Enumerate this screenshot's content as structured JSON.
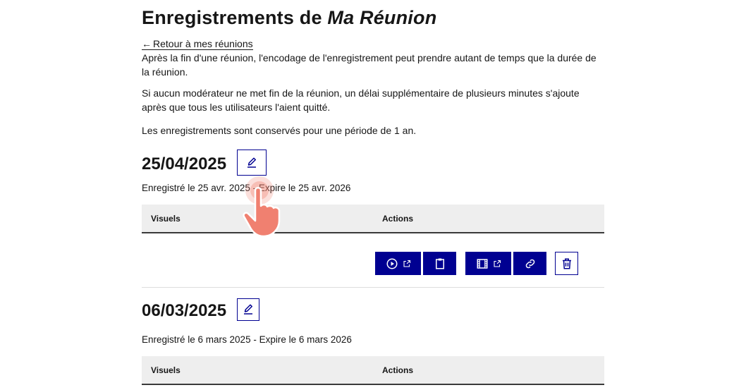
{
  "page": {
    "title_prefix": "Enregistrements de",
    "title_room": "Ma Réunion",
    "back_link": "Retour à mes réunions",
    "info": [
      "Après la fin d'une réunion, l'encodage de l'enregistrement peut prendre autant de temps que la durée de la réunion.",
      "Si aucun modérateur ne met fin de la réunion, un délai supplémentaire de plusieurs minutes s'ajoute après que tous les utilisateurs l'aient quitté.",
      "Les enregistrements sont conservés pour une période de 1 an."
    ]
  },
  "table_headers": {
    "visuals": "Visuels",
    "actions": "Actions"
  },
  "recordings": [
    {
      "title": "25/04/2025",
      "meta": "Enregistré le 25 avr. 2025 - Expire le 25 avr. 2026"
    },
    {
      "title": "06/03/2025",
      "meta": "Enregistré le 6 mars 2025 - Expire le 6 mars 2026"
    }
  ],
  "actions": [
    "play-external-icon",
    "clipboard-icon",
    "film-external-icon",
    "link-icon",
    "trash-icon"
  ],
  "colors": {
    "primary": "#000091",
    "header_bg": "#eeeeee",
    "cursor": "#f08070"
  }
}
